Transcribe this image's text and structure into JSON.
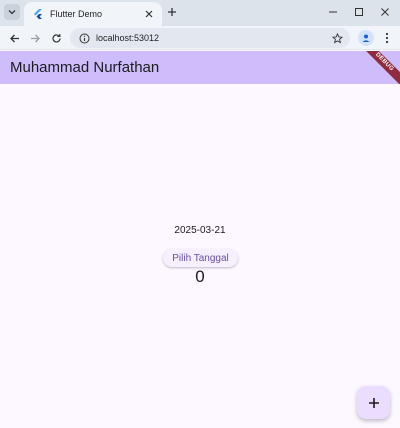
{
  "browser": {
    "tab_title": "Flutter Demo",
    "url": "localhost:53012"
  },
  "app": {
    "title": "Muhammad Nurfathan",
    "debug_banner": "DEBUG",
    "date_text": "2025-03-21",
    "pick_button_label": "Pilih Tanggal",
    "counter_value": "0",
    "fab_icon": "add-icon"
  },
  "colors": {
    "appbar": "#cebdfa",
    "background": "#fdf7ff",
    "fab": "#eaddff",
    "button_text": "#6750a4",
    "debug_banner": "#8d2b3f"
  }
}
